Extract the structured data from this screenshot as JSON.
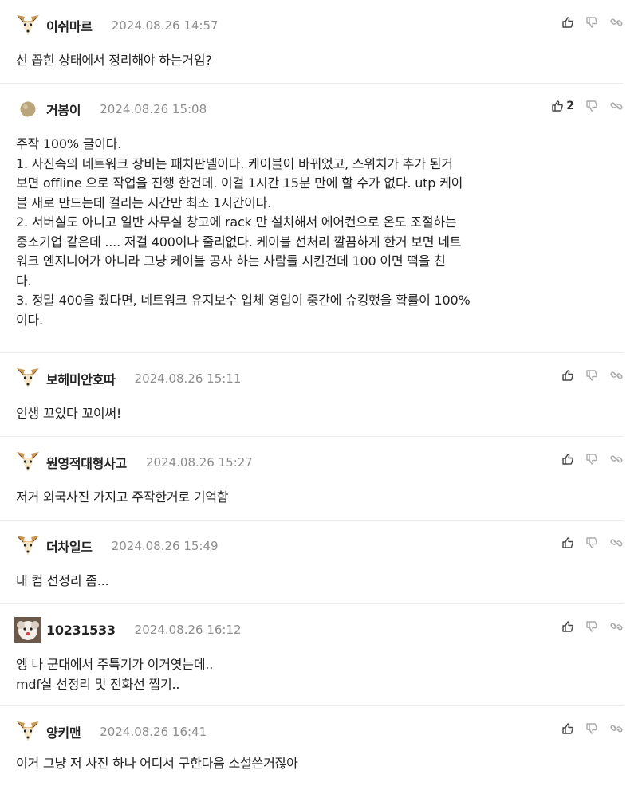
{
  "comments": [
    {
      "author": "이쉬마르",
      "date": "2024.08.26 14:57",
      "avatar": "fennec-icon",
      "likes": "",
      "text": "선 꼽힌 상태에서 정리해야 하는거임?"
    },
    {
      "author": "거봉이",
      "date": "2024.08.26 15:08",
      "avatar": "dot-icon",
      "likes": "2",
      "text": "주작 100% 글이다.\n1. 사진속의 네트워크 장비는 패치판넬이다. 케이블이 바뀌었고, 스위치가 추가 된거\n보면 offline 으로 작업을 진행 한건데. 이걸 1시간 15분 만에 할 수가 없다. utp 케이\n블 새로 만드는데 걸리는 시간만 최소 1시간이다.\n2. 서버실도 아니고 일반 사무실 창고에 rack 만 설치해서 에어컨으로 온도 조절하는\n중소기업 같은데 .... 저걸 400이나 줄리없다. 케이블 선처리 깔끔하게 한거 보면 네트\n워크 엔지니어가 아니라 그냥 케이블 공사 하는 사람들 시킨건데 100 이면 떡을 친\n다.\n3. 정말 400을 줬다면, 네트워크 유지보수 업체 영업이 중간에 슈킹했을 확률이 100%\n이다."
    },
    {
      "author": "보헤미안호따",
      "date": "2024.08.26 15:11",
      "avatar": "fennec-icon",
      "likes": "",
      "text": "인생 꼬있다 꼬이써!"
    },
    {
      "author": "원영적대형사고",
      "date": "2024.08.26 15:27",
      "avatar": "fennec-icon",
      "likes": "",
      "text": "저거 외국사진 가지고 주작한거로 기억함"
    },
    {
      "author": "더차일드",
      "date": "2024.08.26 15:49",
      "avatar": "fennec-icon",
      "likes": "",
      "text": "내 컴 선정리 좀..."
    },
    {
      "author": "10231533",
      "date": "2024.08.26 16:12",
      "avatar": "puppy-photo-icon",
      "likes": "",
      "text": "엥 나 군대에서 주특기가 이거엿는데..\nmdf실 선정리 및 전화선 찝기.."
    },
    {
      "author": "양키맨",
      "date": "2024.08.26 16:41",
      "avatar": "fennec-icon",
      "likes": "",
      "text": "이거 그냥 저 사진 하나 어디서 구한다음 소설쓴거잖아"
    }
  ]
}
